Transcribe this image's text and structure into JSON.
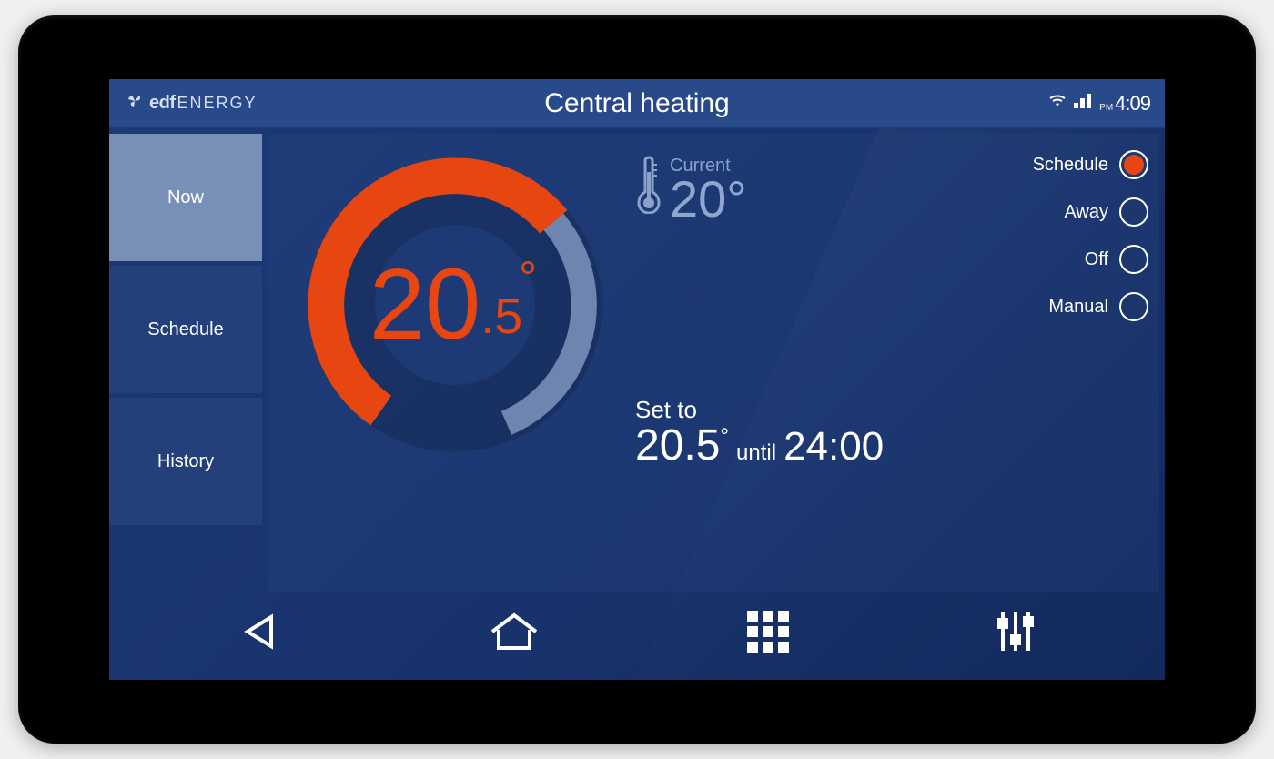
{
  "branding": {
    "brand": "eDF",
    "suffix": "ENERGY"
  },
  "header": {
    "title": "Central heating",
    "clock_ampm": "PM",
    "clock_time": "4:09"
  },
  "sidebar": {
    "items": [
      {
        "label": "Now",
        "active": true
      },
      {
        "label": "Schedule",
        "active": false
      },
      {
        "label": "History",
        "active": false
      }
    ]
  },
  "thermostat": {
    "target_int": "20",
    "target_frac": ".5",
    "current_label": "Current",
    "current_value": "20°",
    "set_label": "Set to",
    "set_temp": "20.5",
    "set_until_label": "until",
    "set_until_time": "24:00",
    "progress": 0.62
  },
  "modes": {
    "options": [
      {
        "label": "Schedule",
        "selected": true
      },
      {
        "label": "Away",
        "selected": false
      },
      {
        "label": "Off",
        "selected": false
      },
      {
        "label": "Manual",
        "selected": false
      }
    ]
  },
  "colors": {
    "accent": "#e84610",
    "ring_bg": "#6d85af"
  }
}
